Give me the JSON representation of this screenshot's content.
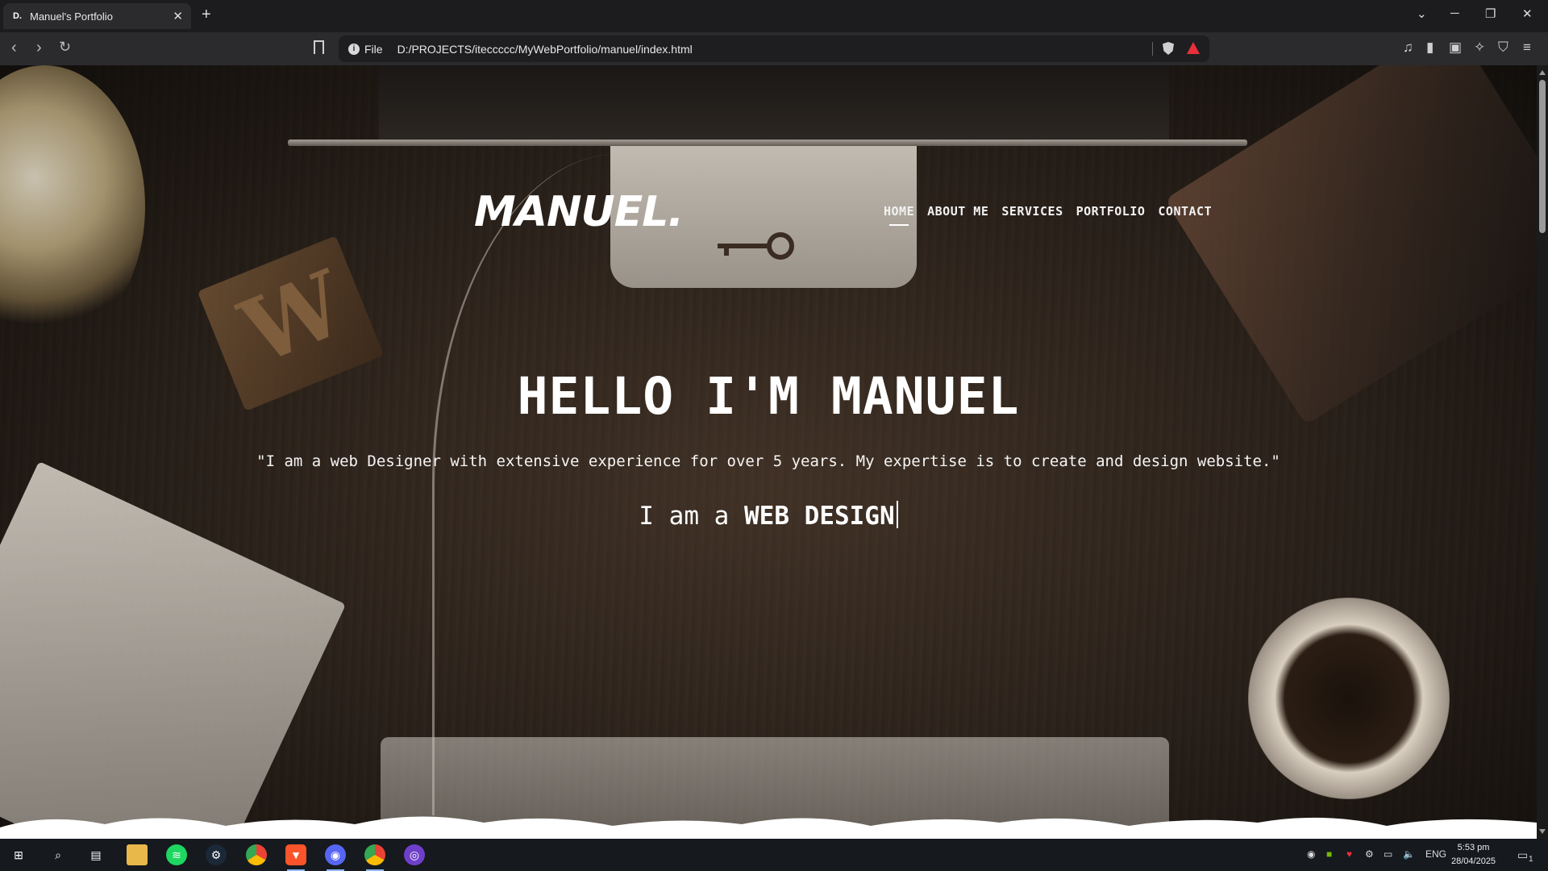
{
  "browser": {
    "tab": {
      "favicon": "D.",
      "title": "Manuel's Portfolio"
    },
    "address": {
      "scheme_label": "File",
      "url": "D:/PROJECTS/iteccccc/MyWebPortfolio/manuel/index.html"
    }
  },
  "site": {
    "logo": "MANUEL.",
    "nav": [
      "HOME",
      "ABOUT ME",
      "SERVICES",
      "PORTFOLIO",
      "CONTACT"
    ],
    "active_nav": "HOME",
    "hero": {
      "title": "HELLO I'M MANUEL",
      "quote": "\"I am a web Designer with extensive experience for over 5 years. My expertise is to create and design website.\"",
      "typed_prefix": "I am a ",
      "typed_word": "WEB DESIGN"
    }
  },
  "taskbar": {
    "apps": [
      "windows-start-icon",
      "search-icon",
      "task-view-icon",
      "file-explorer-icon",
      "spotify-icon",
      "steam-icon",
      "chrome-icon",
      "brave-icon",
      "discord-icon",
      "chrome-profile-icon",
      "github-icon"
    ],
    "language": "ENG",
    "time": "5:53 pm",
    "date": "28/04/2025",
    "notification_count": "1"
  }
}
